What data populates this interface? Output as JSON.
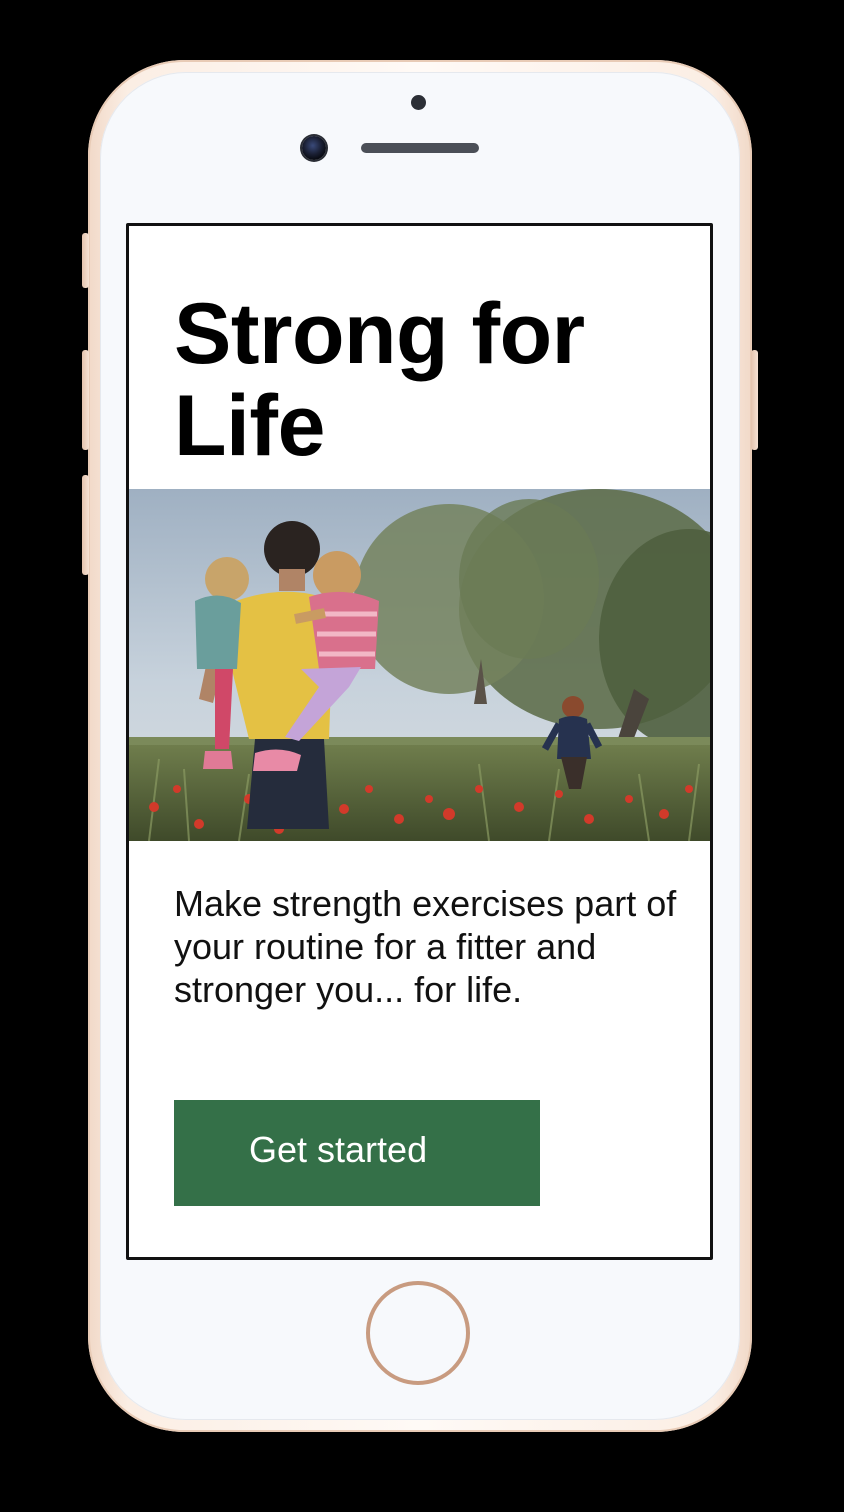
{
  "screen": {
    "headline": "Strong for Life",
    "intro": "Make strength exercises part of your routine for a fitter and stronger you... for life.",
    "cta_label": "Get started"
  },
  "colors": {
    "cta_background": "#347048",
    "cta_text": "#ffffff",
    "headline_text": "#000000",
    "screen_background": "#ffffff",
    "device_frame": "#fbeee4"
  },
  "icons": {
    "front_camera": "front-camera-icon",
    "speaker": "speaker-grille-icon",
    "home_button": "home-button-icon"
  }
}
